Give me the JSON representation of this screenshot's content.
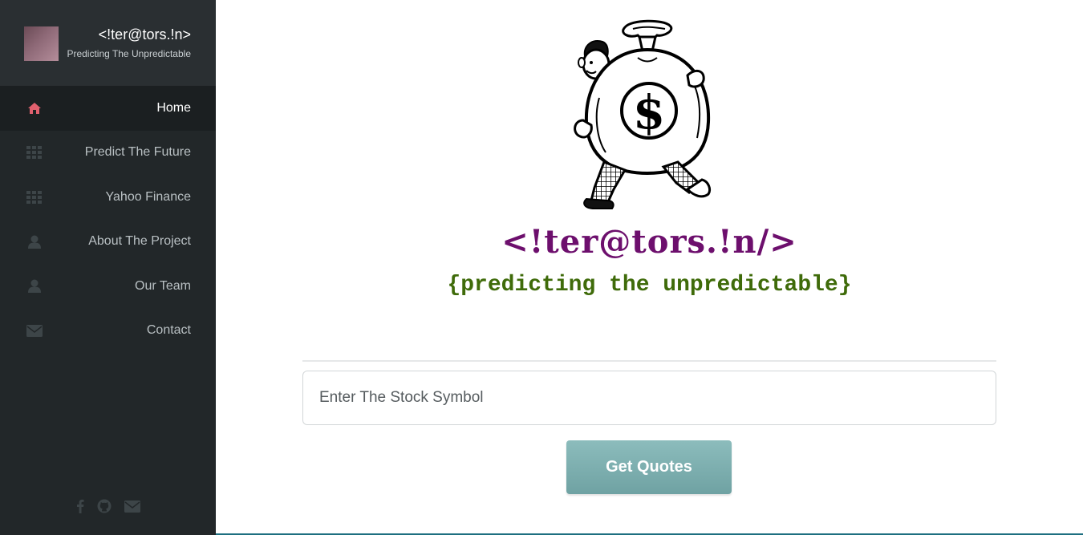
{
  "brand": {
    "title": "<!ter@tors.!n>",
    "subtitle": "Predicting The Unpredictable"
  },
  "nav": {
    "items": [
      {
        "label": "Home",
        "icon": "home-icon",
        "active": true
      },
      {
        "label": "Predict The Future",
        "icon": "grid-icon",
        "active": false
      },
      {
        "label": "Yahoo Finance",
        "icon": "grid-icon",
        "active": false
      },
      {
        "label": "About The Project",
        "icon": "user-icon",
        "active": false
      },
      {
        "label": "Our Team",
        "icon": "user-icon",
        "active": false
      },
      {
        "label": "Contact",
        "icon": "envelope-icon",
        "active": false
      }
    ]
  },
  "social": [
    "facebook-icon",
    "github-icon",
    "envelope-icon"
  ],
  "main": {
    "logo_title": "<!ter@tors.!n/>",
    "tagline": "{predicting the unpredictable}",
    "search": {
      "placeholder": "Enter The Stock Symbol",
      "value": ""
    },
    "button_label": "Get Quotes"
  },
  "colors": {
    "sidebar_bg": "#222729",
    "active_icon": "#e0606e",
    "logo_title": "#6d0f6d",
    "tagline": "#3f6b0a",
    "button": "#7aaeae"
  }
}
